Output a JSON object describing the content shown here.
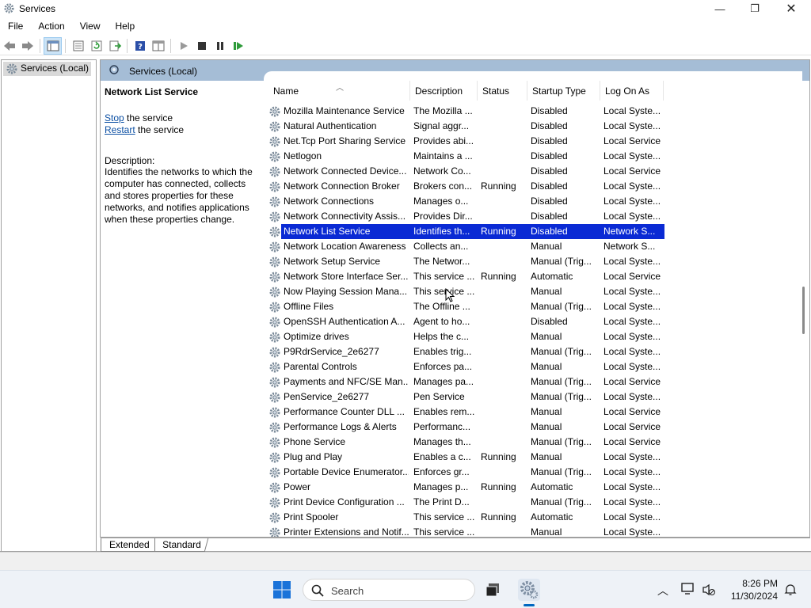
{
  "window": {
    "title": "Services",
    "controls": {
      "minimize": "—",
      "maximize": "❐",
      "close": "✕"
    }
  },
  "menu": [
    "File",
    "Action",
    "View",
    "Help"
  ],
  "toolbar": {
    "icons": [
      "back-icon",
      "forward-icon",
      "show-console-tree-icon",
      "properties-icon",
      "refresh-icon",
      "export-list-icon",
      "help-icon",
      "view-icon",
      "start-service-icon",
      "stop-service-icon",
      "pause-service-icon",
      "resume-service-icon"
    ]
  },
  "tree": {
    "item": "Services (Local)"
  },
  "content": {
    "header": "Services (Local)"
  },
  "details": {
    "title": "Network List Service",
    "stop_link": "Stop",
    "stop_suffix": " the service",
    "restart_link": "Restart",
    "restart_suffix": " the service",
    "description_label": "Description:",
    "description": "Identifies the networks to which the computer has connected, collects and stores properties for these networks, and notifies applications when these properties change."
  },
  "grid": {
    "columns": [
      "Name",
      "Description",
      "Status",
      "Startup Type",
      "Log On As"
    ],
    "selected_index": 8,
    "rows": [
      {
        "name": "Mozilla Maintenance Service",
        "desc": "The Mozilla ...",
        "status": "",
        "startup": "Disabled",
        "logon": "Local Syste..."
      },
      {
        "name": "Natural Authentication",
        "desc": "Signal aggr...",
        "status": "",
        "startup": "Disabled",
        "logon": "Local Syste..."
      },
      {
        "name": "Net.Tcp Port Sharing Service",
        "desc": "Provides abi...",
        "status": "",
        "startup": "Disabled",
        "logon": "Local Service"
      },
      {
        "name": "Netlogon",
        "desc": "Maintains a ...",
        "status": "",
        "startup": "Disabled",
        "logon": "Local Syste..."
      },
      {
        "name": "Network Connected Device...",
        "desc": "Network Co...",
        "status": "",
        "startup": "Disabled",
        "logon": "Local Service"
      },
      {
        "name": "Network Connection Broker",
        "desc": "Brokers con...",
        "status": "Running",
        "startup": "Disabled",
        "logon": "Local Syste..."
      },
      {
        "name": "Network Connections",
        "desc": "Manages o...",
        "status": "",
        "startup": "Disabled",
        "logon": "Local Syste..."
      },
      {
        "name": "Network Connectivity Assis...",
        "desc": "Provides Dir...",
        "status": "",
        "startup": "Disabled",
        "logon": "Local Syste..."
      },
      {
        "name": "Network List Service",
        "desc": "Identifies th...",
        "status": "Running",
        "startup": "Disabled",
        "logon": "Network S..."
      },
      {
        "name": "Network Location Awareness",
        "desc": "Collects an...",
        "status": "",
        "startup": "Manual",
        "logon": "Network S..."
      },
      {
        "name": "Network Setup Service",
        "desc": "The Networ...",
        "status": "",
        "startup": "Manual (Trig...",
        "logon": "Local Syste..."
      },
      {
        "name": "Network Store Interface Ser...",
        "desc": "This service ...",
        "status": "Running",
        "startup": "Automatic",
        "logon": "Local Service"
      },
      {
        "name": "Now Playing Session Mana...",
        "desc": "This service ...",
        "status": "",
        "startup": "Manual",
        "logon": "Local Syste..."
      },
      {
        "name": "Offline Files",
        "desc": "The Offline ...",
        "status": "",
        "startup": "Manual (Trig...",
        "logon": "Local Syste..."
      },
      {
        "name": "OpenSSH Authentication A...",
        "desc": "Agent to ho...",
        "status": "",
        "startup": "Disabled",
        "logon": "Local Syste..."
      },
      {
        "name": "Optimize drives",
        "desc": "Helps the c...",
        "status": "",
        "startup": "Manual",
        "logon": "Local Syste..."
      },
      {
        "name": "P9RdrService_2e6277",
        "desc": "Enables trig...",
        "status": "",
        "startup": "Manual (Trig...",
        "logon": "Local Syste..."
      },
      {
        "name": "Parental Controls",
        "desc": "Enforces pa...",
        "status": "",
        "startup": "Manual",
        "logon": "Local Syste..."
      },
      {
        "name": "Payments and NFC/SE Man...",
        "desc": "Manages pa...",
        "status": "",
        "startup": "Manual (Trig...",
        "logon": "Local Service"
      },
      {
        "name": "PenService_2e6277",
        "desc": "Pen Service",
        "status": "",
        "startup": "Manual (Trig...",
        "logon": "Local Syste..."
      },
      {
        "name": "Performance Counter DLL ...",
        "desc": "Enables rem...",
        "status": "",
        "startup": "Manual",
        "logon": "Local Service"
      },
      {
        "name": "Performance Logs & Alerts",
        "desc": "Performanc...",
        "status": "",
        "startup": "Manual",
        "logon": "Local Service"
      },
      {
        "name": "Phone Service",
        "desc": "Manages th...",
        "status": "",
        "startup": "Manual (Trig...",
        "logon": "Local Service"
      },
      {
        "name": "Plug and Play",
        "desc": "Enables a c...",
        "status": "Running",
        "startup": "Manual",
        "logon": "Local Syste..."
      },
      {
        "name": "Portable Device Enumerator...",
        "desc": "Enforces gr...",
        "status": "",
        "startup": "Manual (Trig...",
        "logon": "Local Syste..."
      },
      {
        "name": "Power",
        "desc": "Manages p...",
        "status": "Running",
        "startup": "Automatic",
        "logon": "Local Syste..."
      },
      {
        "name": "Print Device Configuration ...",
        "desc": "The Print D...",
        "status": "",
        "startup": "Manual (Trig...",
        "logon": "Local Syste..."
      },
      {
        "name": "Print Spooler",
        "desc": "This service ...",
        "status": "Running",
        "startup": "Automatic",
        "logon": "Local Syste..."
      },
      {
        "name": "Printer Extensions and Notif...",
        "desc": "This service ...",
        "status": "",
        "startup": "Manual",
        "logon": "Local Syste..."
      }
    ]
  },
  "tabs": [
    "Extended",
    "Standard"
  ],
  "taskbar": {
    "search_text": "Search",
    "time": "8:26 PM",
    "date": "11/30/2024"
  },
  "colors": {
    "selection": "#0a2ad4",
    "header": "#a5bdd6",
    "link": "#0b4fa3"
  }
}
